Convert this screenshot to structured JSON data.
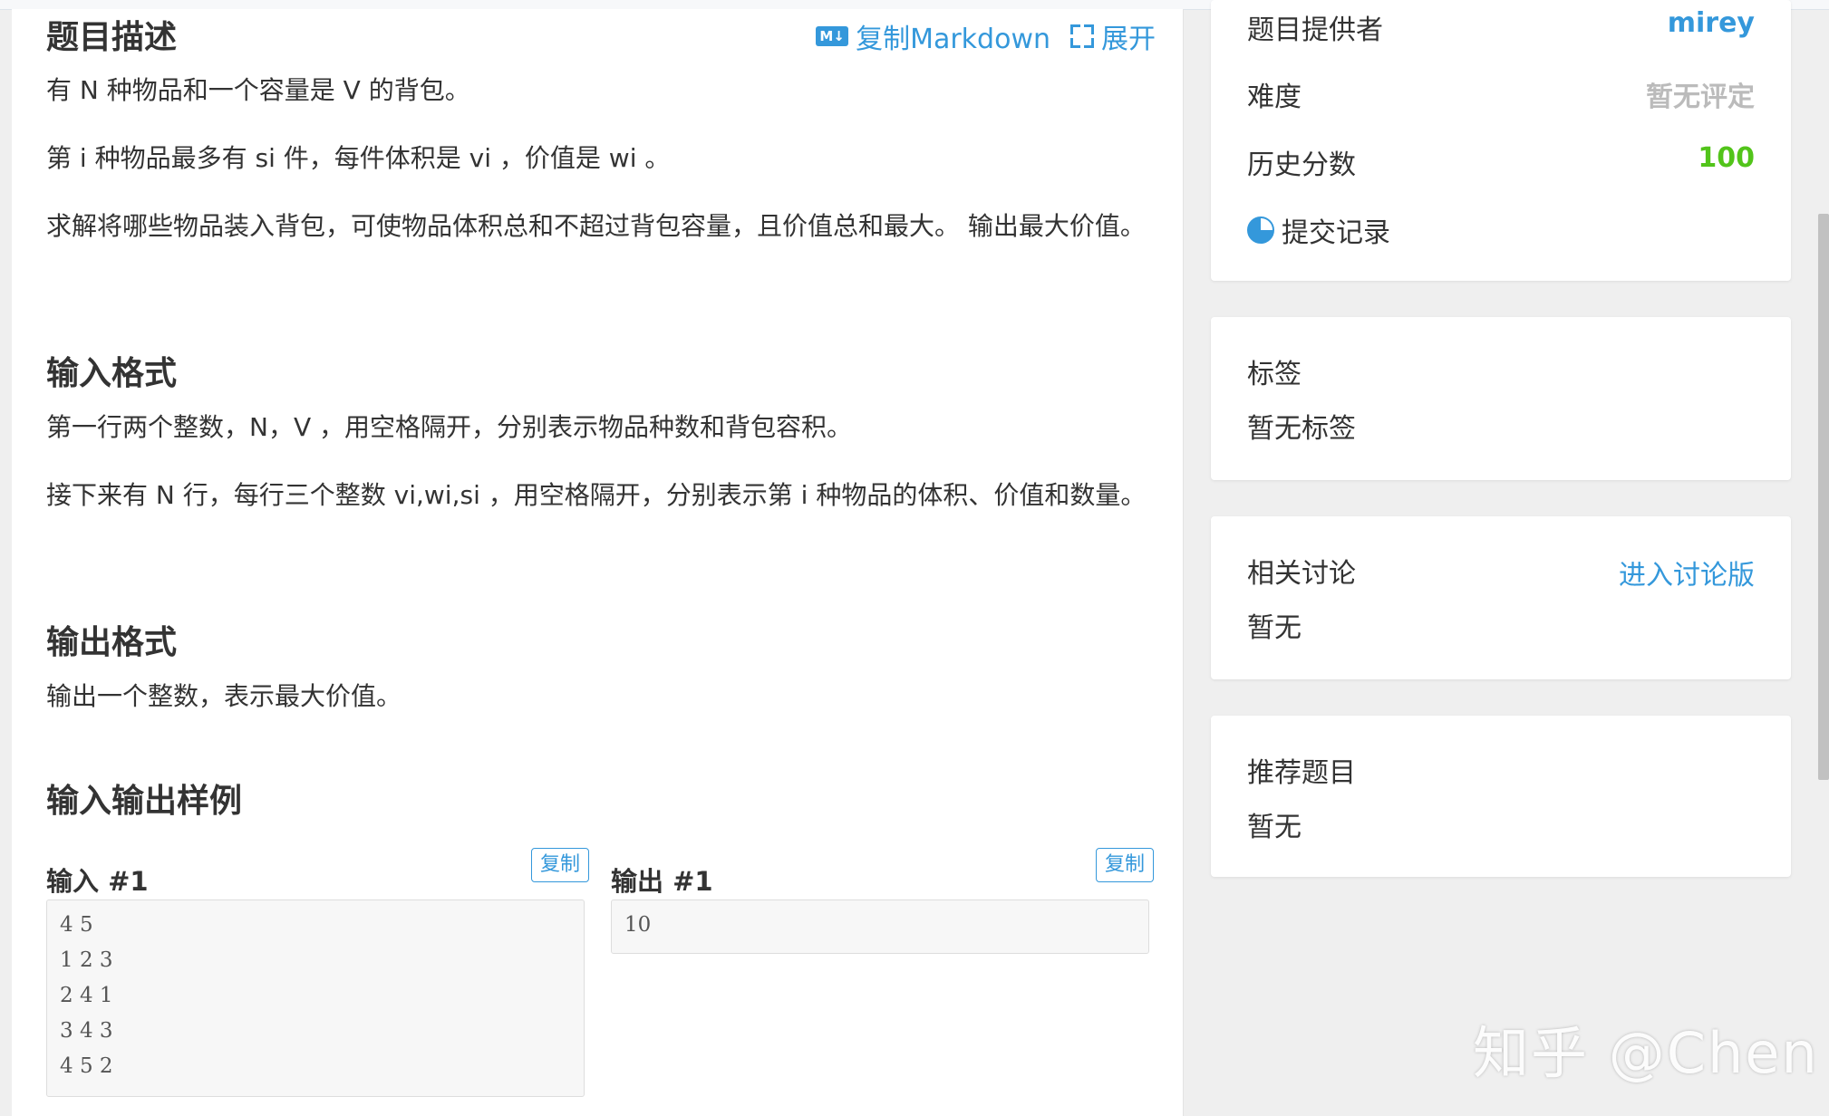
{
  "main": {
    "description_title": "题目描述",
    "toolbar": {
      "copy_markdown": "复制Markdown",
      "expand": "展开"
    },
    "description": [
      "有 N 种物品和一个容量是 V 的背包。",
      "第 i 种物品最多有 si 件，每件体积是 vi ，价值是 wi 。",
      "求解将哪些物品装入背包，可使物品体积总和不超过背包容量，且价值总和最大。 输出最大价值。"
    ],
    "input_title": "输入格式",
    "input_format": [
      "第一行两个整数，N，V ，用空格隔开，分别表示物品种数和背包容积。",
      "接下来有 N 行，每行三个整数 vi,wi,si ，用空格隔开，分别表示第 i 种物品的体积、价值和数量。"
    ],
    "output_title": "输出格式",
    "output_format": "输出一个整数，表示最大价值。",
    "samples_title": "输入输出样例",
    "sample_input_title": "输入 #1",
    "sample_output_title": "输出 #1",
    "copy_label": "复制",
    "sample_input": "4 5\n1 2 3\n2 4 1\n3 4 3\n4 5 2",
    "sample_output": "10"
  },
  "sidebar": {
    "info": {
      "provider_label": "题目提供者",
      "provider_value": "mirey",
      "difficulty_label": "难度",
      "difficulty_value": "暂无评定",
      "history_label": "历史分数",
      "history_value": "100",
      "submissions": "提交记录"
    },
    "tags": {
      "title": "标签",
      "value": "暂无标签"
    },
    "discussion": {
      "title": "相关讨论",
      "link": "进入讨论版",
      "value": "暂无"
    },
    "recommended": {
      "title": "推荐题目",
      "value": "暂无"
    }
  },
  "colors": {
    "accent": "#3498db",
    "score_green": "#52c41a",
    "muted_gray": "#bbbbbb"
  },
  "watermark": "知乎 @Chen"
}
